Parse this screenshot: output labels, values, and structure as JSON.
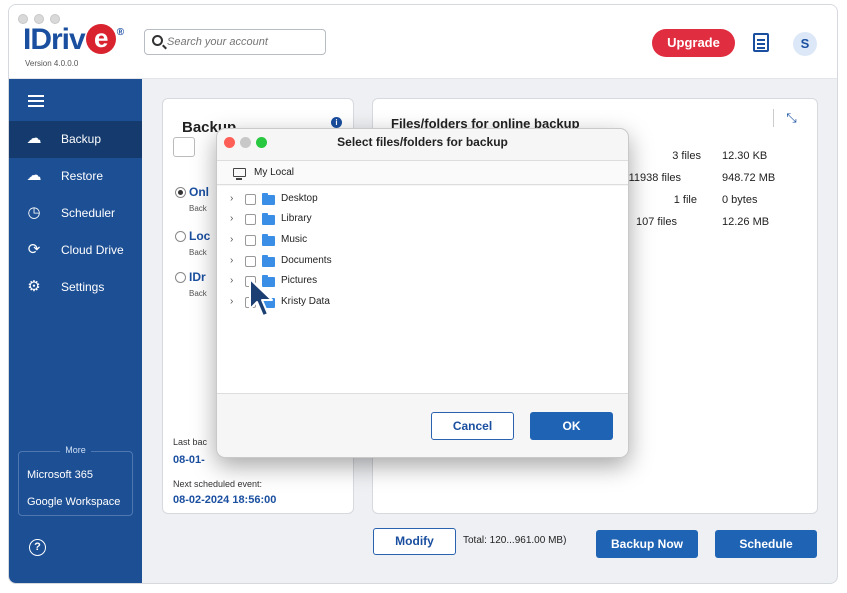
{
  "app": {
    "logo_text": "IDriv",
    "logo_e": "e",
    "logo_reg": "®",
    "version": "Version 4.0.0.0"
  },
  "search": {
    "placeholder": "Search your account"
  },
  "header": {
    "upgrade_label": "Upgrade",
    "avatar_initial": "S"
  },
  "sidebar": {
    "items": [
      {
        "label": "Backup",
        "icon": "cloud-upload-icon",
        "active": true
      },
      {
        "label": "Restore",
        "icon": "cloud-download-icon",
        "active": false
      },
      {
        "label": "Scheduler",
        "icon": "clock-icon",
        "active": false
      },
      {
        "label": "Cloud Drive",
        "icon": "sync-icon",
        "active": false
      },
      {
        "label": "Settings",
        "icon": "gear-icon",
        "active": false
      }
    ],
    "more_label": "More",
    "more_items": [
      "Microsoft 365",
      "Google Workspace"
    ]
  },
  "backup_panel": {
    "title": "Backup",
    "mac_glyph": "",
    "options": [
      {
        "label": "Onl",
        "sub": "Back",
        "checked": true
      },
      {
        "label": "Loc",
        "sub": "Back",
        "checked": false
      },
      {
        "label": "IDr",
        "sub": "Back",
        "checked": false
      }
    ],
    "last_backup_label": "Last bac",
    "last_backup_value": "08-01-",
    "next_event_label": "Next scheduled event:",
    "next_event_value": "08-02-2024 18:56:00"
  },
  "files_panel": {
    "title": "Files/folders for online backup",
    "rows": [
      {
        "count": "3 files",
        "size": "12.30 KB"
      },
      {
        "count": "11938 files",
        "size": "948.72 MB"
      },
      {
        "count": "1 file",
        "size": "0 bytes"
      },
      {
        "count": "107 files",
        "size": "12.26 MB"
      }
    ]
  },
  "bottom_bar": {
    "modify_label": "Modify",
    "total_text": "Total: 120...961.00 MB)",
    "backup_now_label": "Backup Now",
    "schedule_label": "Schedule"
  },
  "dialog": {
    "title": "Select files/folders for backup",
    "location": "My Local",
    "folders": [
      "Desktop",
      "Library",
      "Music",
      "Documents",
      "Pictures",
      "Kristy Data"
    ],
    "cancel_label": "Cancel",
    "ok_label": "OK"
  },
  "colors": {
    "brand_blue": "#1a4fa0",
    "sidebar_bg": "#1d4f94",
    "sidebar_active": "#143a6e",
    "upgrade_red": "#e02d3f",
    "primary_button": "#1f63b5",
    "folder_blue": "#3a8ee6"
  }
}
